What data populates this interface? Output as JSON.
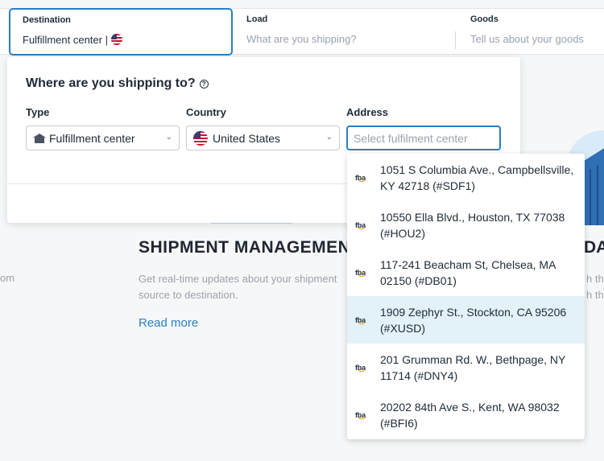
{
  "topbar": {
    "destination": {
      "label": "Destination",
      "value": "Fulfillment center |"
    },
    "load": {
      "label": "Load",
      "placeholder": "What are you shipping?"
    },
    "goods": {
      "label": "Goods",
      "placeholder": "Tell us about your goods"
    }
  },
  "panel": {
    "title": "Where are you shipping to?",
    "type": {
      "label": "Type",
      "value": "Fulfillment center"
    },
    "country": {
      "label": "Country",
      "value": "United States"
    },
    "address": {
      "label": "Address",
      "placeholder": "Select fulfilment center"
    }
  },
  "dropdown": {
    "icon_text": "fba",
    "options": [
      {
        "text": "1051 S Columbia Ave., Campbellsville, KY 42718 (#SDF1)"
      },
      {
        "text": "10550 Ella Blvd., Houston, TX 77038 (#HOU2)"
      },
      {
        "text": "117-241 Beacham St, Chelsea, MA 02150 (#DB01)"
      },
      {
        "text": "1909 Zephyr St., Stockton, CA 95206 (#XUSD)"
      },
      {
        "text": "201 Grumman Rd. W., Bethpage, NY 11714 (#DNY4)"
      },
      {
        "text": "20202 84th Ave S., Kent, WA 98032 (#BFI6)"
      }
    ],
    "highlighted_index": 3
  },
  "background": {
    "heading": "SHIPMENT MANAGEMENT",
    "text": "Get real-time updates about your shipment source to destination.",
    "link": "Read more",
    "left_fragment": "om",
    "right_heading_fragment": "DAT",
    "right_text_fragment_1": "h the",
    "right_text_fragment_2": "h the"
  },
  "colors": {
    "accent": "#2a7ec4",
    "highlight": "#e2f2f8",
    "amazon_orange": "#ff9900"
  }
}
